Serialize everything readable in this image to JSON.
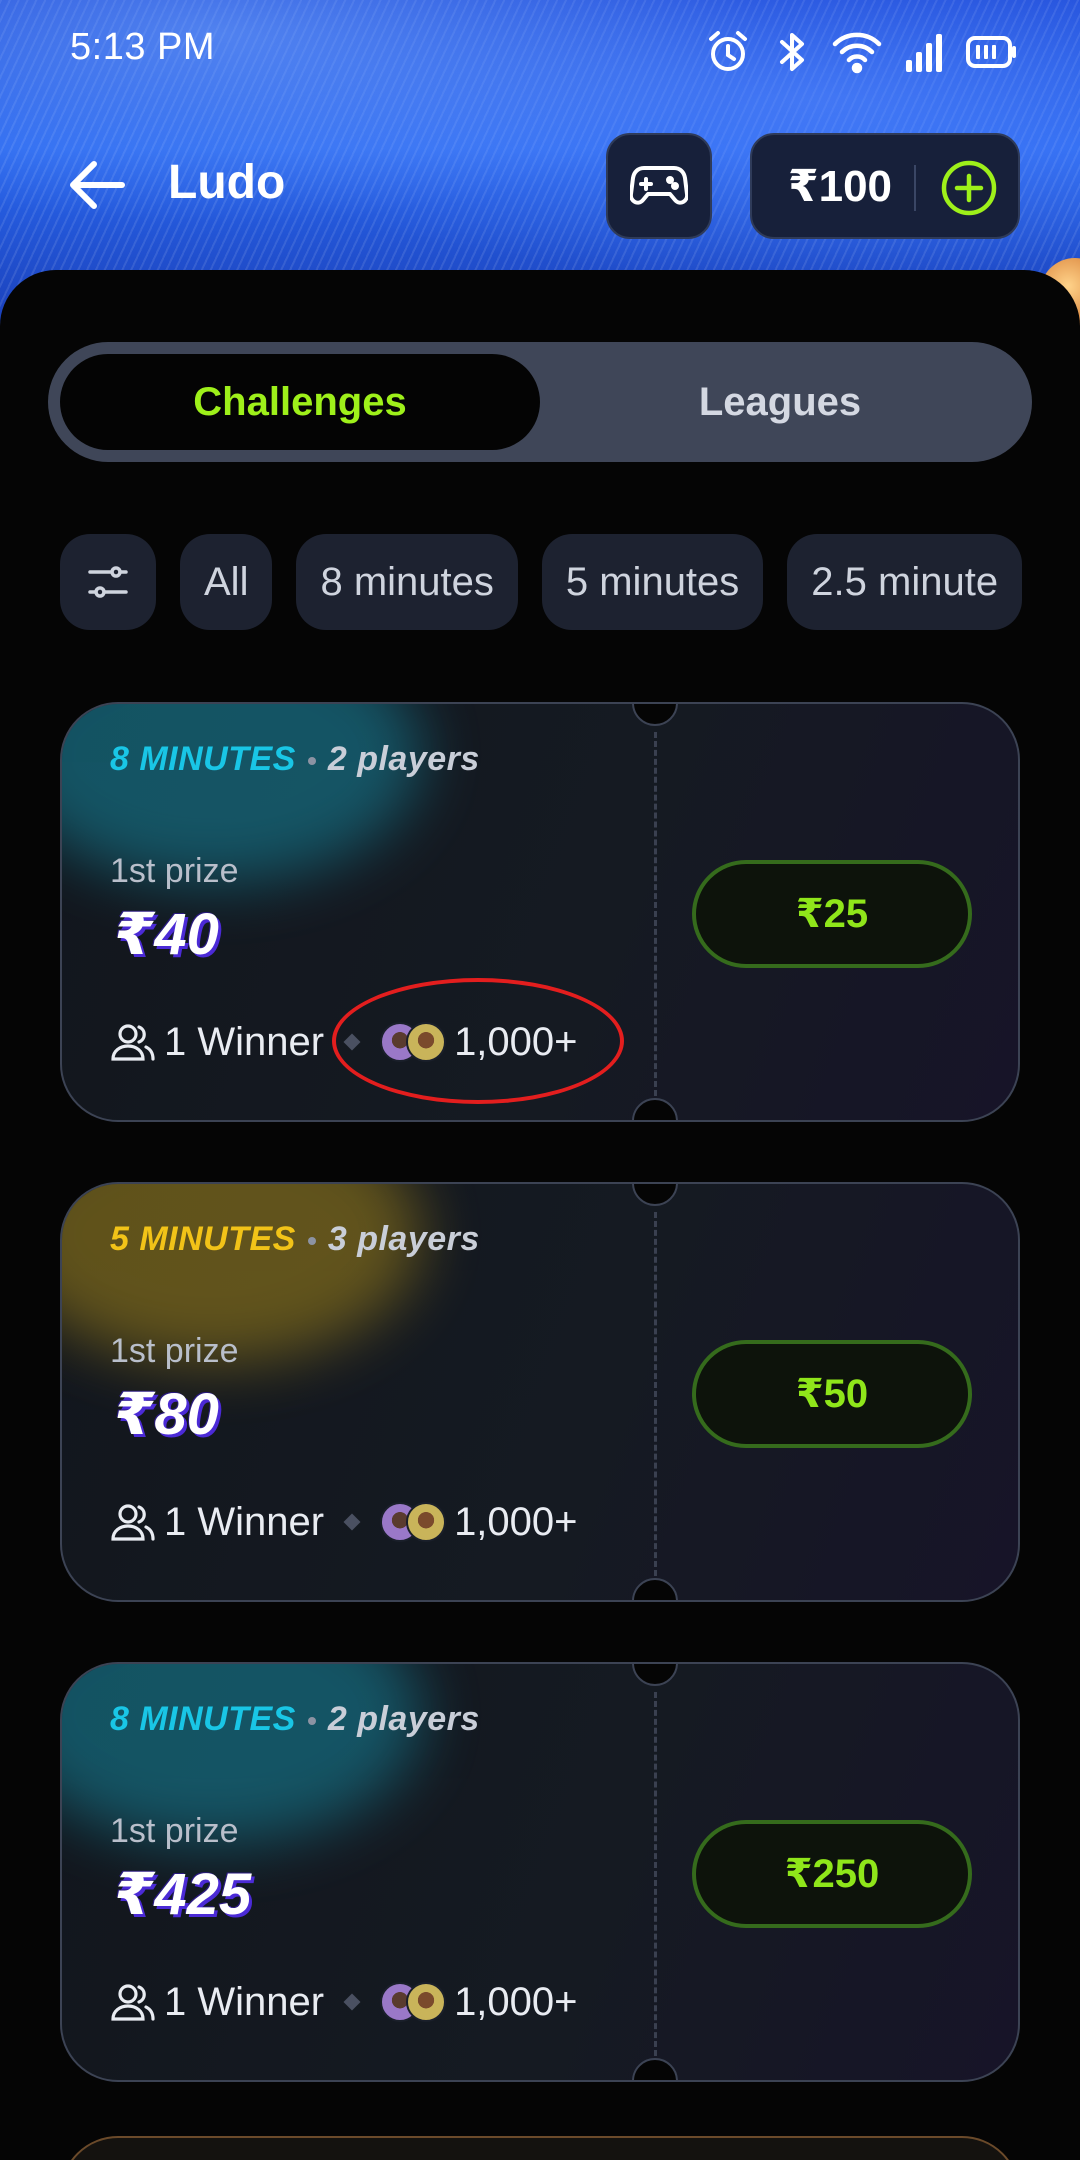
{
  "status_bar": {
    "time": "5:13 PM",
    "icons": [
      "alarm-icon",
      "bluetooth-icon",
      "wifi-icon",
      "signal-icon",
      "battery-icon"
    ]
  },
  "app_bar": {
    "title": "Ludo",
    "wallet_amount": "₹100",
    "back_icon": "back-arrow-icon",
    "game_icon": "gamepad-icon",
    "add_icon": "add-circle-icon"
  },
  "tabs": [
    {
      "label": "Challenges",
      "active": true
    },
    {
      "label": "Leagues",
      "active": false
    }
  ],
  "filters": {
    "icon": "sliders-icon",
    "chips": [
      "All",
      "8 minutes",
      "5 minutes",
      "2.5 minute"
    ]
  },
  "colors": {
    "accent_green": "#9ef01a",
    "cyan": "#19c6e6",
    "yellow": "#f2c318",
    "annotation_red": "#e31e1e"
  },
  "cards": [
    {
      "duration": "8 MINUTES",
      "duration_color": "#19c6e6",
      "players": "2 players",
      "prize_label": "1st prize",
      "prize": "₹40",
      "winners": "1 Winner",
      "joined": "1,000+",
      "entry_fee": "₹25"
    },
    {
      "duration": "5 MINUTES",
      "duration_color": "#f2c318",
      "players": "3 players",
      "prize_label": "1st prize",
      "prize": "₹80",
      "winners": "1 Winner",
      "joined": "1,000+",
      "entry_fee": "₹50"
    },
    {
      "duration": "8 MINUTES",
      "duration_color": "#19c6e6",
      "players": "2 players",
      "prize_label": "1st prize",
      "prize": "₹425",
      "winners": "1 Winner",
      "joined": "1,000+",
      "entry_fee": "₹250"
    }
  ]
}
